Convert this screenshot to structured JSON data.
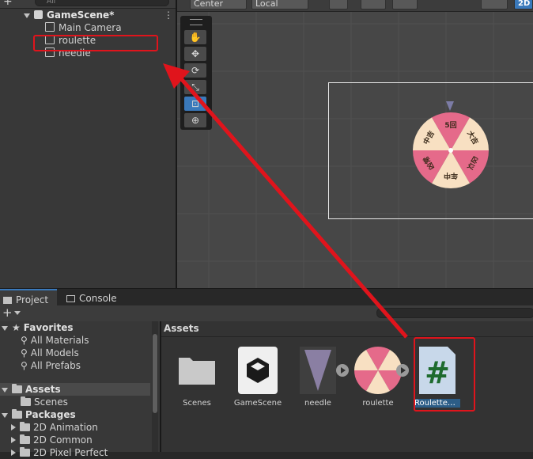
{
  "hierarchy": {
    "search_placeholder": "All",
    "scene_name": "GameScene*",
    "items": [
      {
        "label": "Main Camera"
      },
      {
        "label": "roulette"
      },
      {
        "label": "needle"
      }
    ]
  },
  "scene_toolbar": {
    "pivot_label": "Center",
    "space_label": "Local",
    "mode_label": "2D"
  },
  "roulette_wheel": {
    "colors": [
      "#e56a8a",
      "#f8e0c2"
    ],
    "segment_labels": [
      "5回",
      "大吉",
      "凶以",
      "年中",
      "凶常",
      "中吉"
    ]
  },
  "bottom_tabs": {
    "project": "Project",
    "console": "Console"
  },
  "project_tree": {
    "favorites_label": "Favorites",
    "favorites": [
      "All Materials",
      "All Models",
      "All Prefabs"
    ],
    "assets_label": "Assets",
    "assets_children": [
      "Scenes"
    ],
    "packages_label": "Packages",
    "packages": [
      "2D Animation",
      "2D Common",
      "2D Pixel Perfect"
    ]
  },
  "asset_grid": {
    "breadcrumb": "Assets",
    "items": [
      {
        "label": "Scenes",
        "icon": "folder-icon"
      },
      {
        "label": "GameScene",
        "icon": "unity-scene-icon"
      },
      {
        "label": "needle",
        "icon": "needle-sprite-icon"
      },
      {
        "label": "roulette",
        "icon": "roulette-sprite-icon"
      },
      {
        "label": "RouletteC…",
        "icon": "csharp-script-icon"
      }
    ]
  },
  "annotation": {
    "highlight_color": "#e0141c"
  }
}
